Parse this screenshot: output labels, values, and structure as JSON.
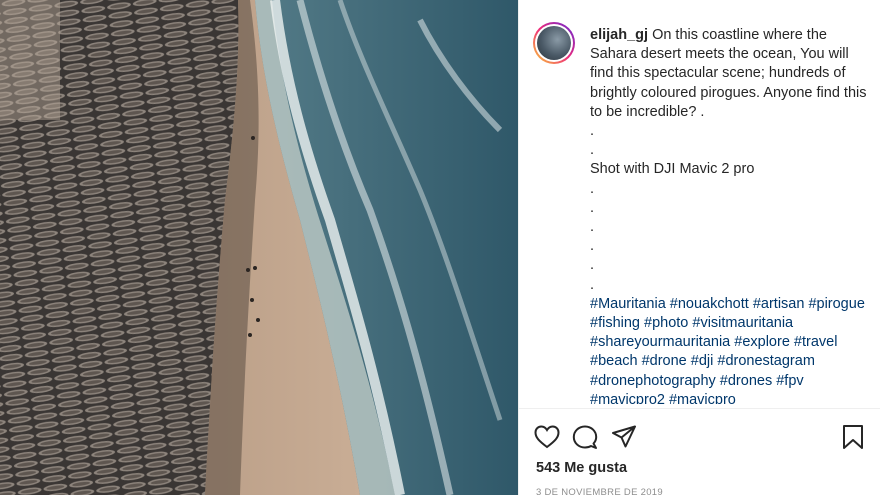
{
  "post": {
    "username": "elijah_gj",
    "caption_lines": [
      "On this coastline where the Sahara desert meets the ocean, You will find this spectacular scene; hundreds of brightly coloured pirogues. Anyone find this to be incredible? .",
      ".",
      ".",
      "Shot with DJI Mavic 2 pro",
      ".",
      ".",
      ".",
      ".",
      ".",
      "."
    ],
    "hashtags": "#Mauritania #nouakchott #artisan #pirogue #fishing #photo #visitmauritania #shareyourmauritania #explore #travel #beach #drone #dji #dronestagram #dronephotography #drones #fpv #mavicpro2 #mavicpro",
    "likes": "543 Me gusta",
    "date": "3 DE NOVIEMBRE DE 2019"
  },
  "icons": {
    "like": "heart-icon",
    "comment": "comment-icon",
    "share": "share-icon",
    "save": "bookmark-icon"
  },
  "colors": {
    "text": "#262626",
    "hashtag": "#00376b",
    "muted": "#8e8e8e",
    "border": "#efefef"
  }
}
